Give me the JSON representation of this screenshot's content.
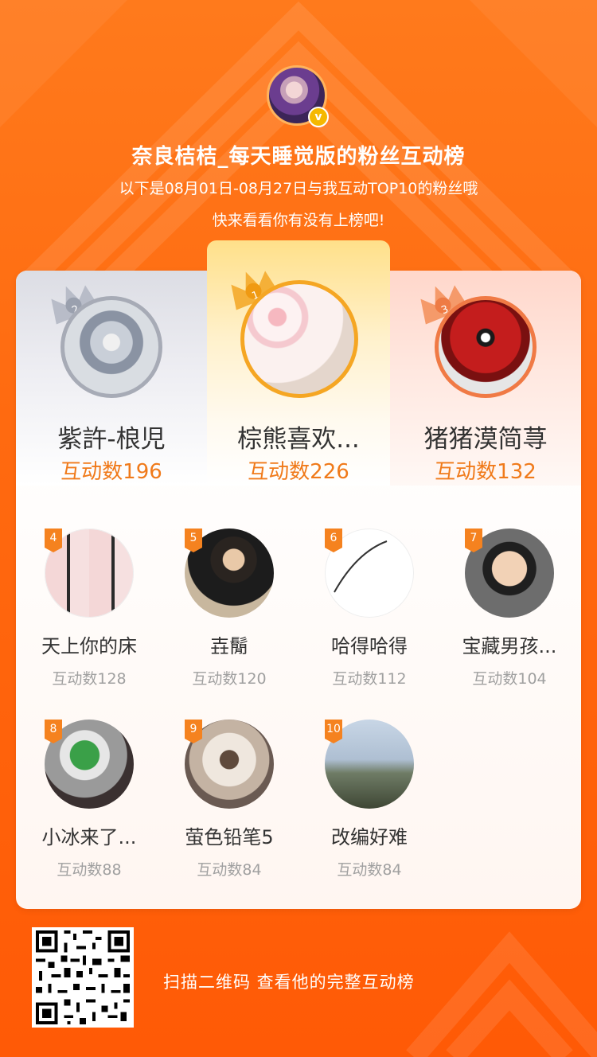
{
  "header": {
    "title": "奈良桔桔_每天睡觉版的粉丝互动榜",
    "subtitle": "以下是08月01日-08月27日与我互动TOP10的粉丝哦",
    "subtitle2": "快来看看你有没有上榜吧!",
    "verify_badge": "v"
  },
  "top3": [
    {
      "rank": "1",
      "name": "棕熊喜欢...",
      "score": "互动数226"
    },
    {
      "rank": "2",
      "name": "紫許-桹児",
      "score": "互动数196"
    },
    {
      "rank": "3",
      "name": "猪猪漠简荨",
      "score": "互动数132"
    }
  ],
  "fans": [
    {
      "rank": "4",
      "name": "天上你的床",
      "score": "互动数128"
    },
    {
      "rank": "5",
      "name": "壵鬜",
      "score": "互动数120"
    },
    {
      "rank": "6",
      "name": "哈得哈得",
      "score": "互动数112"
    },
    {
      "rank": "7",
      "name": "宝藏男孩...",
      "score": "互动数104"
    },
    {
      "rank": "8",
      "name": "小冰来了...",
      "score": "互动数88"
    },
    {
      "rank": "9",
      "name": "萤色铅笔5",
      "score": "互动数84"
    },
    {
      "rank": "10",
      "name": "改编好难",
      "score": "互动数84"
    }
  ],
  "footer": {
    "qr_text": "扫描二维码 查看他的完整互动榜"
  },
  "colors": {
    "background": "#ff6a10",
    "score_top": "#f07a1a",
    "score_other": "#a0a0a0",
    "gold": "#f5a623",
    "silver": "#b8bcc8",
    "bronze": "#f08a55"
  }
}
